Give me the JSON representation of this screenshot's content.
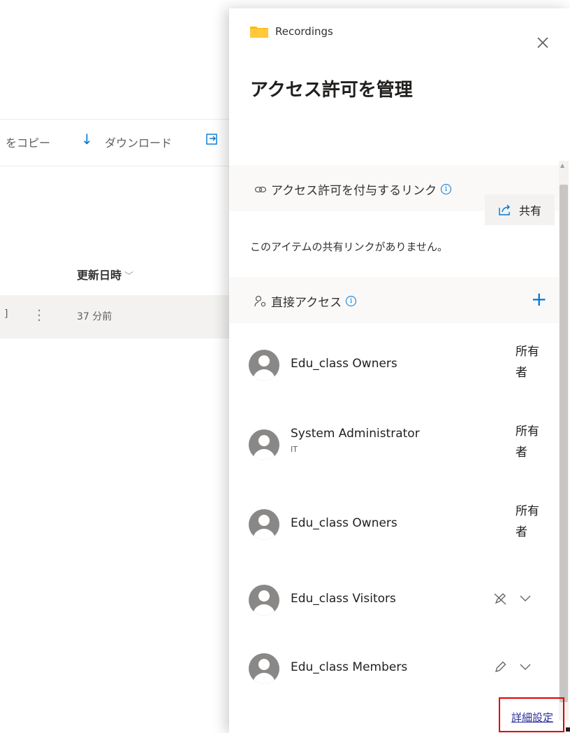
{
  "background": {
    "toolbar": {
      "copy_label": "をコピー",
      "download_label": "ダウンロード"
    },
    "column_header": "更新日時",
    "row": {
      "modified": "37 分前"
    }
  },
  "panel": {
    "folder_name": "Recordings",
    "title": "アクセス許可を管理",
    "links_section": {
      "title": "アクセス許可を付与するリンク",
      "share_label": "共有",
      "empty_text": "このアイテムの共有リンクがありません。"
    },
    "direct_section": {
      "title": "直接アクセス",
      "people": [
        {
          "name": "Edu_class Owners",
          "subtitle": "",
          "role": "所有者"
        },
        {
          "name": "System Administrator",
          "subtitle": "IT",
          "role": "所有者"
        },
        {
          "name": "Edu_class Owners",
          "subtitle": "",
          "role": "所有者"
        },
        {
          "name": "Edu_class Visitors",
          "subtitle": "",
          "permission_icon": "no-edit-pencil-icon"
        },
        {
          "name": "Edu_class Members",
          "subtitle": "",
          "permission_icon": "edit-pencil-icon"
        }
      ]
    },
    "advanced_label": "詳細設定"
  },
  "colors": {
    "accent": "#0078d4",
    "highlight_border": "#e00000",
    "link": "#2b2c9a",
    "section_bg": "#faf9f8"
  }
}
